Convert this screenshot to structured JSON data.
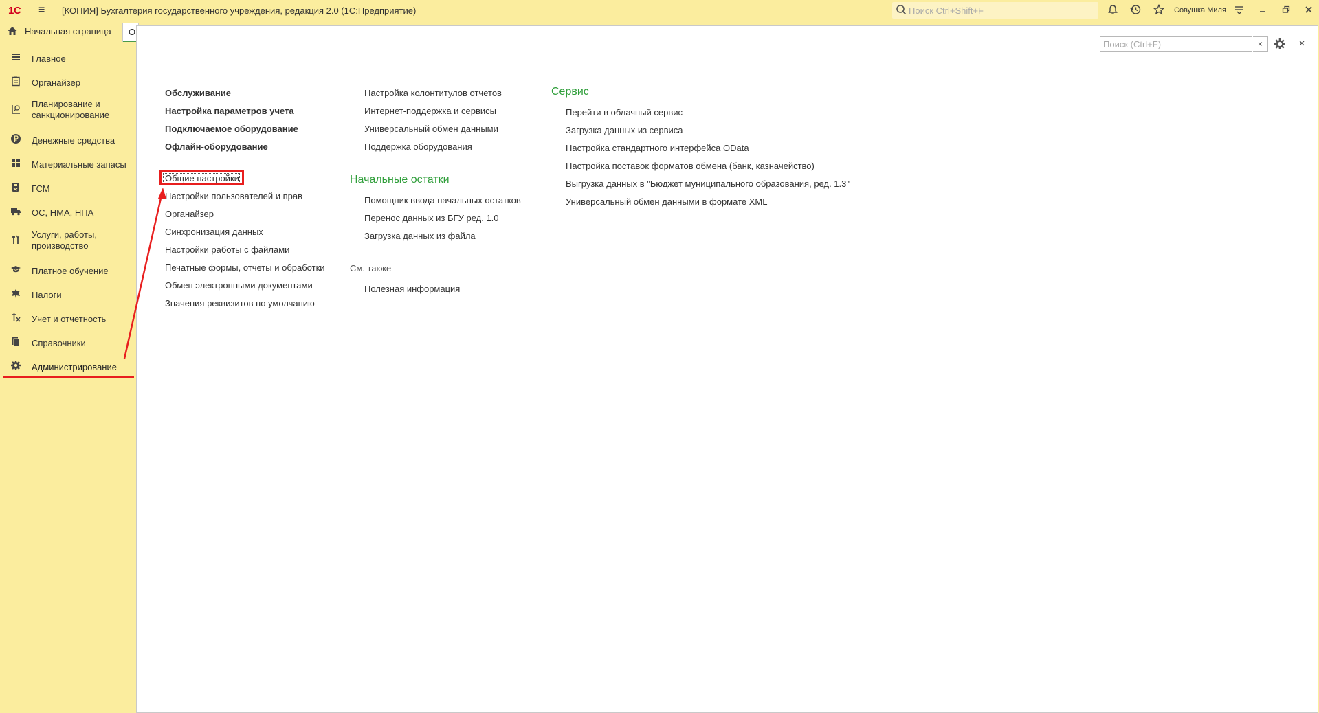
{
  "titlebar": {
    "logo": "1С",
    "title": "[КОПИЯ] Бухгалтерия государственного учреждения, редакция 2.0  (1С:Предприятие)",
    "search_placeholder": "Поиск Ctrl+Shift+F",
    "user": "Совушка Миля",
    "icons": [
      "bell-icon",
      "history-icon",
      "star-icon",
      "menu-settings-icon",
      "minimize-icon",
      "restore-icon",
      "close-icon"
    ]
  },
  "tabs": {
    "home_label": "Начальная страница",
    "second_label": "О"
  },
  "sidebar": {
    "items": [
      {
        "label": "Главное",
        "icon": "list-icon"
      },
      {
        "label": "Органайзер",
        "icon": "clipboard-icon"
      },
      {
        "label": "Планирование и санкционирование",
        "icon": "planning-icon"
      },
      {
        "label": "Денежные средства",
        "icon": "ruble-icon"
      },
      {
        "label": "Материальные запасы",
        "icon": "grid-icon"
      },
      {
        "label": "ГСМ",
        "icon": "fuel-icon"
      },
      {
        "label": "ОС, НМА, НПА",
        "icon": "truck-icon"
      },
      {
        "label": "Услуги, работы, производство",
        "icon": "tools-icon"
      },
      {
        "label": "Платное обучение",
        "icon": "graduation-icon"
      },
      {
        "label": "Налоги",
        "icon": "emblem-icon"
      },
      {
        "label": "Учет и отчетность",
        "icon": "accounting-icon"
      },
      {
        "label": "Справочники",
        "icon": "books-icon"
      },
      {
        "label": "Администрирование",
        "icon": "gear-icon",
        "active": true
      }
    ]
  },
  "panel": {
    "search_placeholder": "Поиск (Ctrl+F)",
    "clear_label": "×",
    "close_label": "×"
  },
  "columns": {
    "col1_bold": [
      "Обслуживание",
      "Настройка параметров учета",
      "Подключаемое оборудование",
      "Офлайн-оборудование"
    ],
    "col1_links": [
      "Общие настройки",
      "Настройки пользователей и прав",
      "Органайзер",
      "Синхронизация данных",
      "Настройки работы с файлами",
      "Печатные формы, отчеты и обработки",
      "Обмен электронными документами",
      "Значения реквизитов по умолчанию"
    ],
    "col2_links": [
      "Настройка колонтитулов отчетов",
      "Интернет-поддержка и сервисы",
      "Универсальный обмен данными",
      "Поддержка оборудования"
    ],
    "col2_section": "Начальные остатки",
    "col2_section_links": [
      "Помощник ввода начальных остатков",
      "Перенос данных из БГУ ред. 1.0",
      "Загрузка данных из файла"
    ],
    "col2_see_also": "См. также",
    "col2_see_also_links": [
      "Полезная информация"
    ],
    "col3_section": "Сервис",
    "col3_links": [
      "Перейти в облачный сервис",
      "Загрузка данных из сервиса",
      "Настройка стандартного интерфейса OData",
      "Настройка поставок форматов обмена (банк, казначейство)",
      "Выгрузка данных в \"Бюджет муниципального образования, ред. 1.3\"",
      "Универсальный обмен данными в формате XML"
    ]
  },
  "colors": {
    "sidebar_bg": "#fbed9e",
    "section_green": "#2f9e3a",
    "annotation_red": "#e81e1e"
  }
}
